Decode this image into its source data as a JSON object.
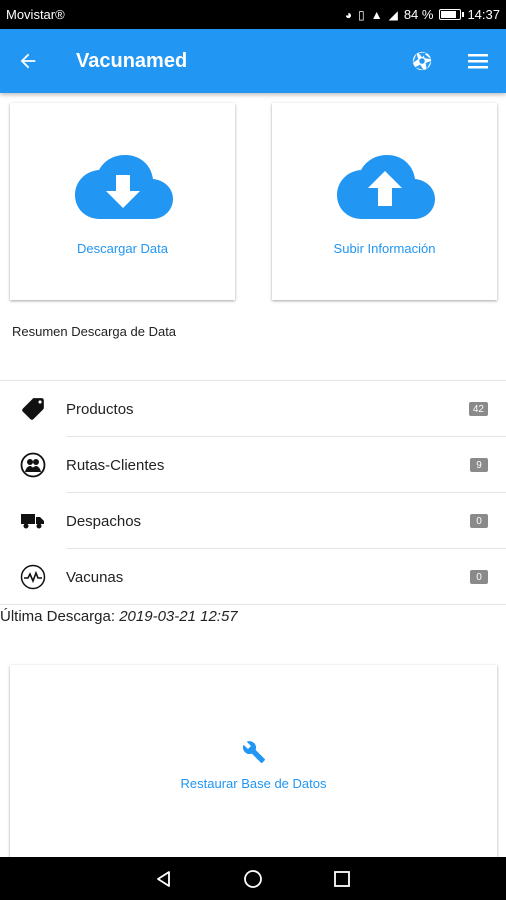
{
  "status_bar": {
    "carrier": "Movistar",
    "carrier_suffix": "®",
    "battery_text": "84 %",
    "battery_level": 0.84,
    "time": "14:37"
  },
  "app_bar": {
    "title": "Vacunamed",
    "back_icon": "arrow-left-icon",
    "sync_icon": "aperture-icon",
    "menu_icon": "hamburger-menu-icon"
  },
  "cards": {
    "download_label": "Descargar Data",
    "upload_label": "Subir Información",
    "restore_label": "Restaurar Base de Datos"
  },
  "summary": {
    "title": "Resumen Descarga de Data",
    "items": [
      {
        "label": "Productos",
        "count": "42",
        "icon": "tag-icon"
      },
      {
        "label": "Rutas-Clientes",
        "count": "9",
        "icon": "people-circle-icon"
      },
      {
        "label": "Despachos",
        "count": "0",
        "icon": "truck-icon"
      },
      {
        "label": "Vacunas",
        "count": "0",
        "icon": "pulse-icon"
      }
    ]
  },
  "last_download": {
    "label": "Última Descarga:",
    "value": "2019-03-21 12:57"
  },
  "colors": {
    "primary": "#2196f3",
    "badge": "#8a8a8a"
  }
}
